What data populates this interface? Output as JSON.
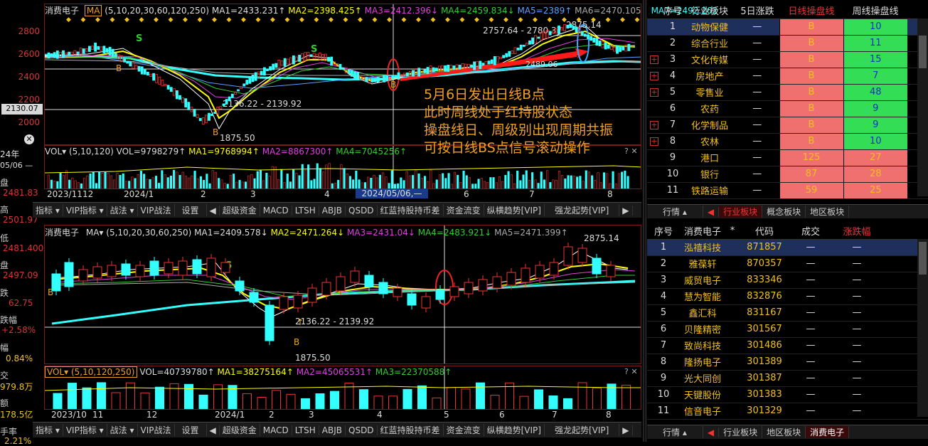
{
  "top_chart": {
    "stock": "消费电子",
    "ma_mode": "MA",
    "ma_params": "(5,10,20,30,60,120,250)",
    "ma_values": [
      "MA1=2433.231↑",
      "MA2=2398.425↑",
      "MA3=2412.396↓",
      "MA4=2459.834↓",
      "MA5=2389↑",
      "MA6=2470.105↓",
      "MA7=2492.262"
    ],
    "price_ticks": [
      "2800",
      "2600",
      "2400",
      "2200",
      "2000"
    ],
    "cursor_price": "2130.07",
    "annotations": [
      "2757.64 - 2780.37",
      "2875.14",
      "2489.06",
      "2136.22 - 2139.92",
      "1875.50",
      "S",
      "S",
      "B",
      "B",
      "B"
    ],
    "vol_params": "VOL▾ (5,10,120)",
    "vol_values": [
      "VOL=9798279↑",
      "MA1=9768994↑",
      "MA2=8867300↑",
      "MA4=7045256↑"
    ],
    "date_ticks": [
      "2023/11",
      "12",
      "2024/1",
      "2",
      "3",
      "4",
      "2024/05/06,—",
      "6",
      "7",
      "8"
    ]
  },
  "bottom_chart": {
    "stock": "消费电子",
    "ma_mode": "MA▾",
    "ma_params": "(5,10,20,30,60,250)",
    "ma_values": [
      "MA1=2409.578↓",
      "MA2=2471.264↓",
      "MA3=2431.04↓",
      "MA4=2483.921↓",
      "MA5=2471.399↑"
    ],
    "annotations": [
      "2875.14",
      "2136.22 - 2139.92",
      "1875.50",
      "S",
      "B",
      "B"
    ],
    "vol_params": "VOL▾ (5,10,120,250)",
    "vol_values": [
      "VOL=40739780↑",
      "MA1=38275164↑",
      "MA2=45065531↑",
      "MA3=22370588↑"
    ],
    "date_ticks": [
      "2023/10",
      "11",
      "12",
      "2024/1",
      "2",
      "3",
      "4",
      "5",
      "6",
      "7",
      "8"
    ]
  },
  "annotation_text": [
    "5月6日发出日线B点",
    "此时周线处于红持股状态",
    "操盘线日、周级别出现周期共振",
    "可按日线BS点信号滚动操作"
  ],
  "left_panel": {
    "date1": "24年",
    "date2": "05/06 —",
    "labels": [
      "盘",
      "高",
      "低",
      "盘",
      "跌",
      "跌幅",
      "幅",
      "交",
      "额",
      "手率"
    ],
    "values": [
      "2481.83",
      "2501.97",
      "2481.400",
      "2497.09",
      "62.75",
      "+2.58%",
      "0.84%",
      "979.8万",
      "178.5亿",
      "2.21%"
    ]
  },
  "toolbar": [
    "指标 ▾",
    "VIP指标 ▾",
    "战法 ▾",
    "VIP战法",
    "设置",
    "◀",
    "超级资金",
    "MACD",
    "LTSH",
    "ABJB",
    "QSDD",
    "红蓝持股持币差",
    "资金流变",
    "纵横趋势[VIP]",
    "强龙起势[VIP]",
    "▶"
  ],
  "sector_table": {
    "headers": [
      "序号",
      "行业板块",
      "5日涨跌",
      "日线操盘线",
      "周线操盘线"
    ],
    "rows": [
      [
        "1",
        "动物保健",
        "—",
        "B",
        "10"
      ],
      [
        "2",
        "综合行业",
        "—",
        "B",
        "11"
      ],
      [
        "3",
        "文化传媒",
        "—",
        "B",
        "15"
      ],
      [
        "4",
        "房地产",
        "—",
        "B",
        "7"
      ],
      [
        "5",
        "零售业",
        "—",
        "B",
        "48"
      ],
      [
        "6",
        "农药",
        "—",
        "B",
        "9"
      ],
      [
        "7",
        "化学制品",
        "—",
        "B",
        "9"
      ],
      [
        "8",
        "农林",
        "—",
        "B",
        "10"
      ],
      [
        "9",
        "港口",
        "—",
        "125",
        "27"
      ],
      [
        "10",
        "银行",
        "—",
        "87",
        "28"
      ],
      [
        "11",
        "铁路运输",
        "—",
        "59",
        "25"
      ]
    ],
    "tabs": [
      "行情 ▴",
      "◀",
      "行业板块",
      "概念板块",
      "地区板块"
    ]
  },
  "stock_table": {
    "headers": [
      "序号",
      "消费电子",
      "*",
      "代码",
      "成交",
      "涨跌幅"
    ],
    "rows": [
      [
        "1",
        "泓禧科技",
        "871857",
        "—",
        "—"
      ],
      [
        "2",
        "雅葆轩",
        "870357",
        "—",
        "—"
      ],
      [
        "3",
        "威贸电子",
        "833346",
        "—",
        "—"
      ],
      [
        "4",
        "慧为智能",
        "832876",
        "—",
        "—"
      ],
      [
        "5",
        "鑫汇科",
        "831167",
        "—",
        "—"
      ],
      [
        "6",
        "贝隆精密",
        "301567",
        "—",
        "—"
      ],
      [
        "7",
        "致尚科技",
        "301486",
        "—",
        "—"
      ],
      [
        "8",
        "隆扬电子",
        "301389",
        "—",
        "—"
      ],
      [
        "9",
        "光大同创",
        "301387",
        "—",
        "—"
      ],
      [
        "10",
        "天键股份",
        "301383",
        "—",
        "—"
      ],
      [
        "11",
        "信音电子",
        "301329",
        "—",
        "—"
      ]
    ],
    "tabs": [
      "行情 ▴",
      "◀",
      "行业板块",
      "地区板块",
      "消费电子"
    ]
  }
}
